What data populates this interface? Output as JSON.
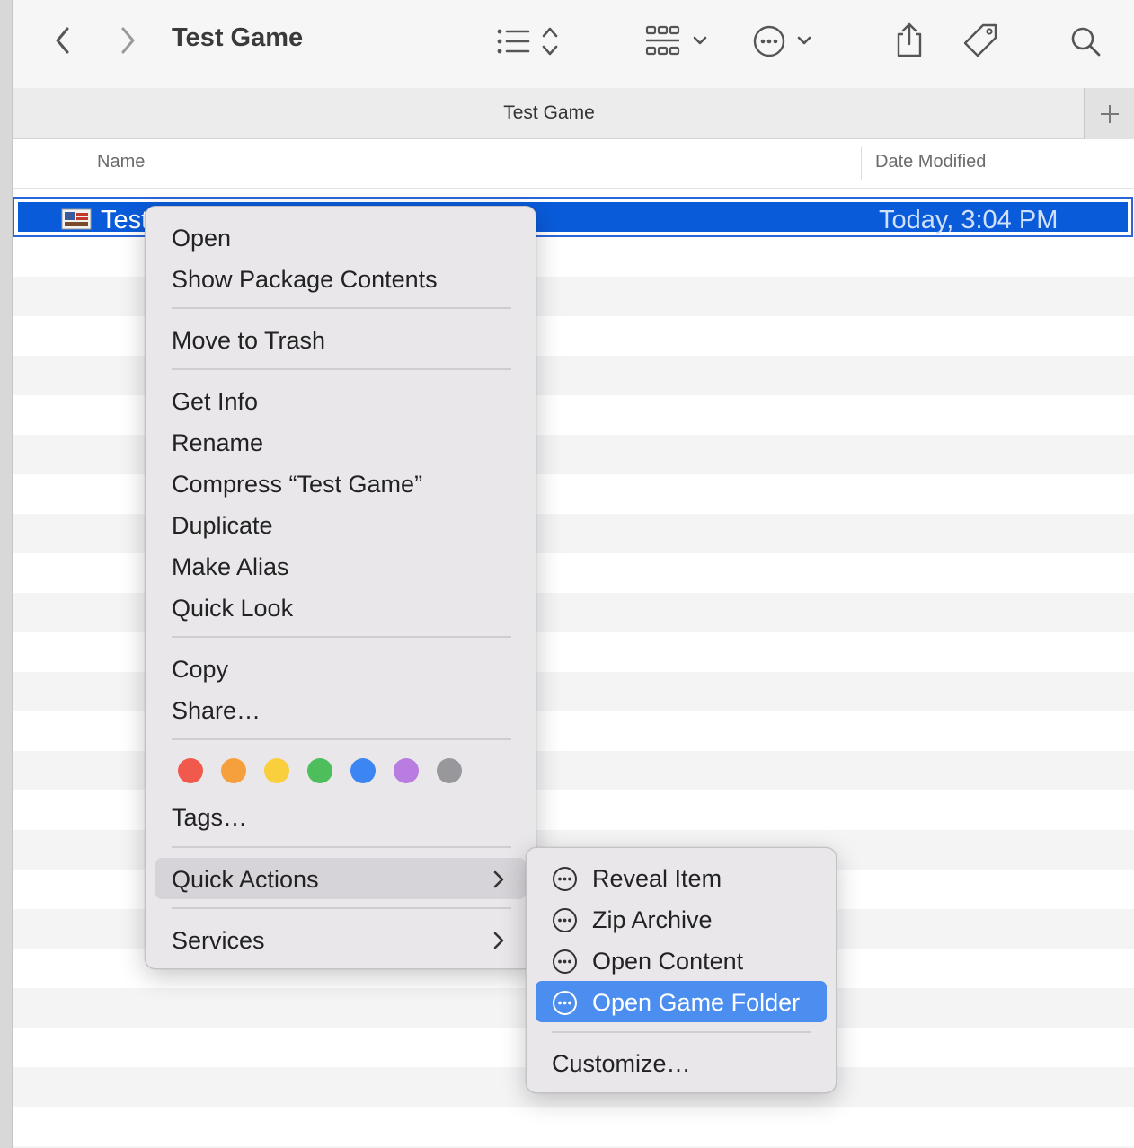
{
  "window": {
    "title": "Test Game"
  },
  "toolbar": {
    "icons": [
      "chevron-left-icon",
      "chevron-right-icon",
      "list-view-icon",
      "group-icon",
      "more-actions-icon",
      "share-icon",
      "tag-icon",
      "search-icon"
    ]
  },
  "tabbar": {
    "tab_title": "Test Game"
  },
  "columns": {
    "name": "Name",
    "date_modified": "Date Modified"
  },
  "file": {
    "name": "Test",
    "date": "Today, 3:04 PM"
  },
  "context_menu": {
    "open": "Open",
    "show_package_contents": "Show Package Contents",
    "move_to_trash": "Move to Trash",
    "get_info": "Get Info",
    "rename": "Rename",
    "compress": "Compress “Test Game”",
    "duplicate": "Duplicate",
    "make_alias": "Make Alias",
    "quick_look": "Quick Look",
    "copy": "Copy",
    "share": "Share…",
    "tag_colors": [
      "#f1594c",
      "#f5a03c",
      "#f9cf3d",
      "#4ebd5b",
      "#3b86f3",
      "#b97ce0",
      "#98989c"
    ],
    "tags": "Tags…",
    "quick_actions": "Quick Actions",
    "services": "Services"
  },
  "quick_actions_submenu": {
    "reveal_item": "Reveal Item",
    "zip_archive": "Zip Archive",
    "open_content": "Open Content",
    "open_game_folder": "Open Game Folder",
    "customize": "Customize…"
  },
  "colors": {
    "selection": "#0a5bd9",
    "highlight": "#4c8eef"
  }
}
